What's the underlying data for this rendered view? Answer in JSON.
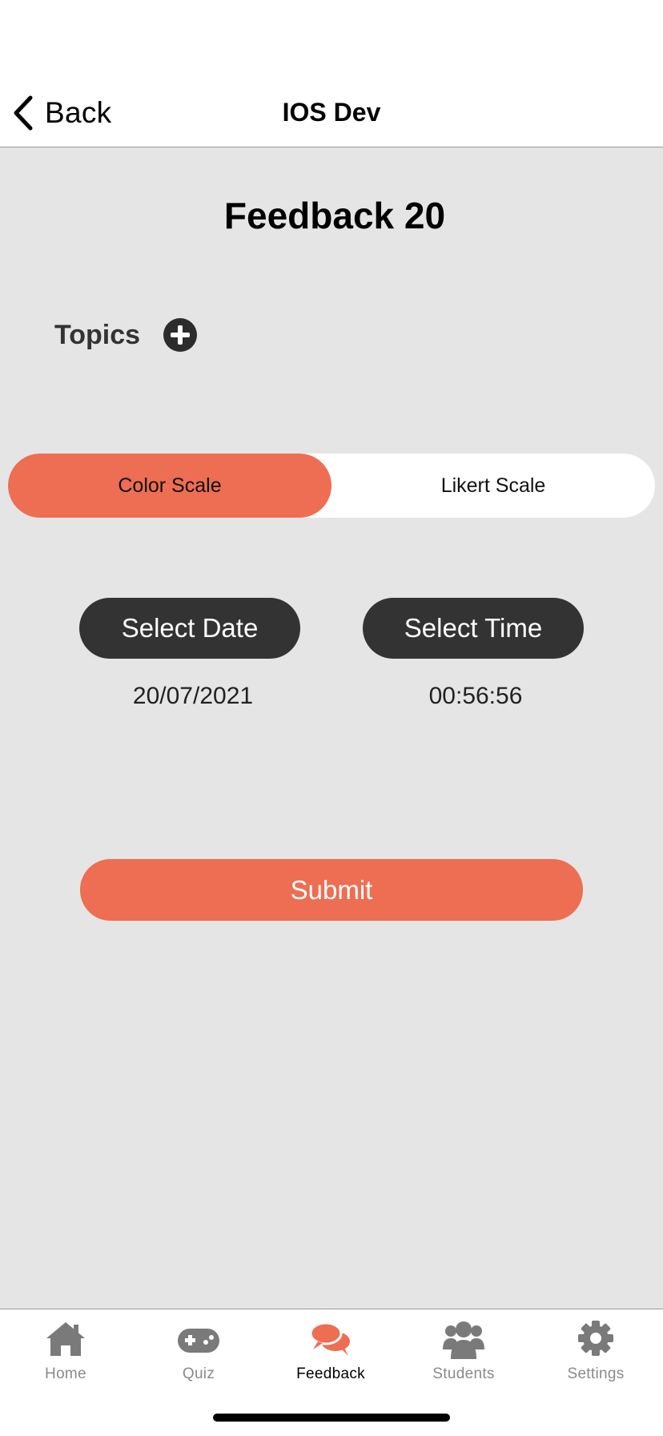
{
  "nav": {
    "back_label": "Back",
    "title": "IOS Dev"
  },
  "main": {
    "title": "Feedback 20",
    "topics_label": "Topics",
    "segments": [
      {
        "label": "Color Scale",
        "selected": true
      },
      {
        "label": "Likert Scale",
        "selected": false
      }
    ],
    "select_date_label": "Select Date",
    "select_time_label": "Select Time",
    "date_value": "20/07/2021",
    "time_value": "00:56:56",
    "submit_label": "Submit"
  },
  "tab_bar": {
    "active": "Feedback",
    "tabs": [
      {
        "label": "Home",
        "icon": "home-icon"
      },
      {
        "label": "Quiz",
        "icon": "gamepad-icon"
      },
      {
        "label": "Feedback",
        "icon": "chat-bubbles-icon"
      },
      {
        "label": "Students",
        "icon": "users-icon"
      },
      {
        "label": "Settings",
        "icon": "gear-icon"
      }
    ]
  },
  "colors": {
    "accent": "#ed6e53",
    "dark_button": "#333333",
    "background": "#e5e5e5",
    "inactive_tab": "#8a8a8a"
  }
}
